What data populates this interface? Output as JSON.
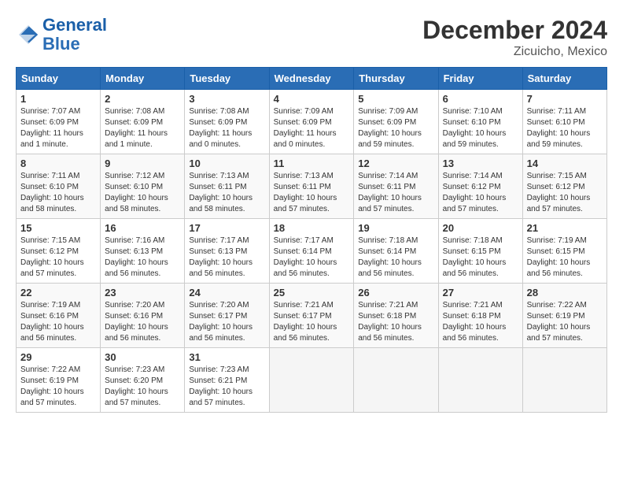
{
  "header": {
    "logo_line1": "General",
    "logo_line2": "Blue",
    "month": "December 2024",
    "location": "Zicuicho, Mexico"
  },
  "weekdays": [
    "Sunday",
    "Monday",
    "Tuesday",
    "Wednesday",
    "Thursday",
    "Friday",
    "Saturday"
  ],
  "weeks": [
    [
      {
        "day": "1",
        "info": "Sunrise: 7:07 AM\nSunset: 6:09 PM\nDaylight: 11 hours\nand 1 minute."
      },
      {
        "day": "2",
        "info": "Sunrise: 7:08 AM\nSunset: 6:09 PM\nDaylight: 11 hours\nand 1 minute."
      },
      {
        "day": "3",
        "info": "Sunrise: 7:08 AM\nSunset: 6:09 PM\nDaylight: 11 hours\nand 0 minutes."
      },
      {
        "day": "4",
        "info": "Sunrise: 7:09 AM\nSunset: 6:09 PM\nDaylight: 11 hours\nand 0 minutes."
      },
      {
        "day": "5",
        "info": "Sunrise: 7:09 AM\nSunset: 6:09 PM\nDaylight: 10 hours\nand 59 minutes."
      },
      {
        "day": "6",
        "info": "Sunrise: 7:10 AM\nSunset: 6:10 PM\nDaylight: 10 hours\nand 59 minutes."
      },
      {
        "day": "7",
        "info": "Sunrise: 7:11 AM\nSunset: 6:10 PM\nDaylight: 10 hours\nand 59 minutes."
      }
    ],
    [
      {
        "day": "8",
        "info": "Sunrise: 7:11 AM\nSunset: 6:10 PM\nDaylight: 10 hours\nand 58 minutes."
      },
      {
        "day": "9",
        "info": "Sunrise: 7:12 AM\nSunset: 6:10 PM\nDaylight: 10 hours\nand 58 minutes."
      },
      {
        "day": "10",
        "info": "Sunrise: 7:13 AM\nSunset: 6:11 PM\nDaylight: 10 hours\nand 58 minutes."
      },
      {
        "day": "11",
        "info": "Sunrise: 7:13 AM\nSunset: 6:11 PM\nDaylight: 10 hours\nand 57 minutes."
      },
      {
        "day": "12",
        "info": "Sunrise: 7:14 AM\nSunset: 6:11 PM\nDaylight: 10 hours\nand 57 minutes."
      },
      {
        "day": "13",
        "info": "Sunrise: 7:14 AM\nSunset: 6:12 PM\nDaylight: 10 hours\nand 57 minutes."
      },
      {
        "day": "14",
        "info": "Sunrise: 7:15 AM\nSunset: 6:12 PM\nDaylight: 10 hours\nand 57 minutes."
      }
    ],
    [
      {
        "day": "15",
        "info": "Sunrise: 7:15 AM\nSunset: 6:12 PM\nDaylight: 10 hours\nand 57 minutes."
      },
      {
        "day": "16",
        "info": "Sunrise: 7:16 AM\nSunset: 6:13 PM\nDaylight: 10 hours\nand 56 minutes."
      },
      {
        "day": "17",
        "info": "Sunrise: 7:17 AM\nSunset: 6:13 PM\nDaylight: 10 hours\nand 56 minutes."
      },
      {
        "day": "18",
        "info": "Sunrise: 7:17 AM\nSunset: 6:14 PM\nDaylight: 10 hours\nand 56 minutes."
      },
      {
        "day": "19",
        "info": "Sunrise: 7:18 AM\nSunset: 6:14 PM\nDaylight: 10 hours\nand 56 minutes."
      },
      {
        "day": "20",
        "info": "Sunrise: 7:18 AM\nSunset: 6:15 PM\nDaylight: 10 hours\nand 56 minutes."
      },
      {
        "day": "21",
        "info": "Sunrise: 7:19 AM\nSunset: 6:15 PM\nDaylight: 10 hours\nand 56 minutes."
      }
    ],
    [
      {
        "day": "22",
        "info": "Sunrise: 7:19 AM\nSunset: 6:16 PM\nDaylight: 10 hours\nand 56 minutes."
      },
      {
        "day": "23",
        "info": "Sunrise: 7:20 AM\nSunset: 6:16 PM\nDaylight: 10 hours\nand 56 minutes."
      },
      {
        "day": "24",
        "info": "Sunrise: 7:20 AM\nSunset: 6:17 PM\nDaylight: 10 hours\nand 56 minutes."
      },
      {
        "day": "25",
        "info": "Sunrise: 7:21 AM\nSunset: 6:17 PM\nDaylight: 10 hours\nand 56 minutes."
      },
      {
        "day": "26",
        "info": "Sunrise: 7:21 AM\nSunset: 6:18 PM\nDaylight: 10 hours\nand 56 minutes."
      },
      {
        "day": "27",
        "info": "Sunrise: 7:21 AM\nSunset: 6:18 PM\nDaylight: 10 hours\nand 56 minutes."
      },
      {
        "day": "28",
        "info": "Sunrise: 7:22 AM\nSunset: 6:19 PM\nDaylight: 10 hours\nand 57 minutes."
      }
    ],
    [
      {
        "day": "29",
        "info": "Sunrise: 7:22 AM\nSunset: 6:19 PM\nDaylight: 10 hours\nand 57 minutes."
      },
      {
        "day": "30",
        "info": "Sunrise: 7:23 AM\nSunset: 6:20 PM\nDaylight: 10 hours\nand 57 minutes."
      },
      {
        "day": "31",
        "info": "Sunrise: 7:23 AM\nSunset: 6:21 PM\nDaylight: 10 hours\nand 57 minutes."
      },
      {
        "day": "",
        "info": ""
      },
      {
        "day": "",
        "info": ""
      },
      {
        "day": "",
        "info": ""
      },
      {
        "day": "",
        "info": ""
      }
    ]
  ]
}
